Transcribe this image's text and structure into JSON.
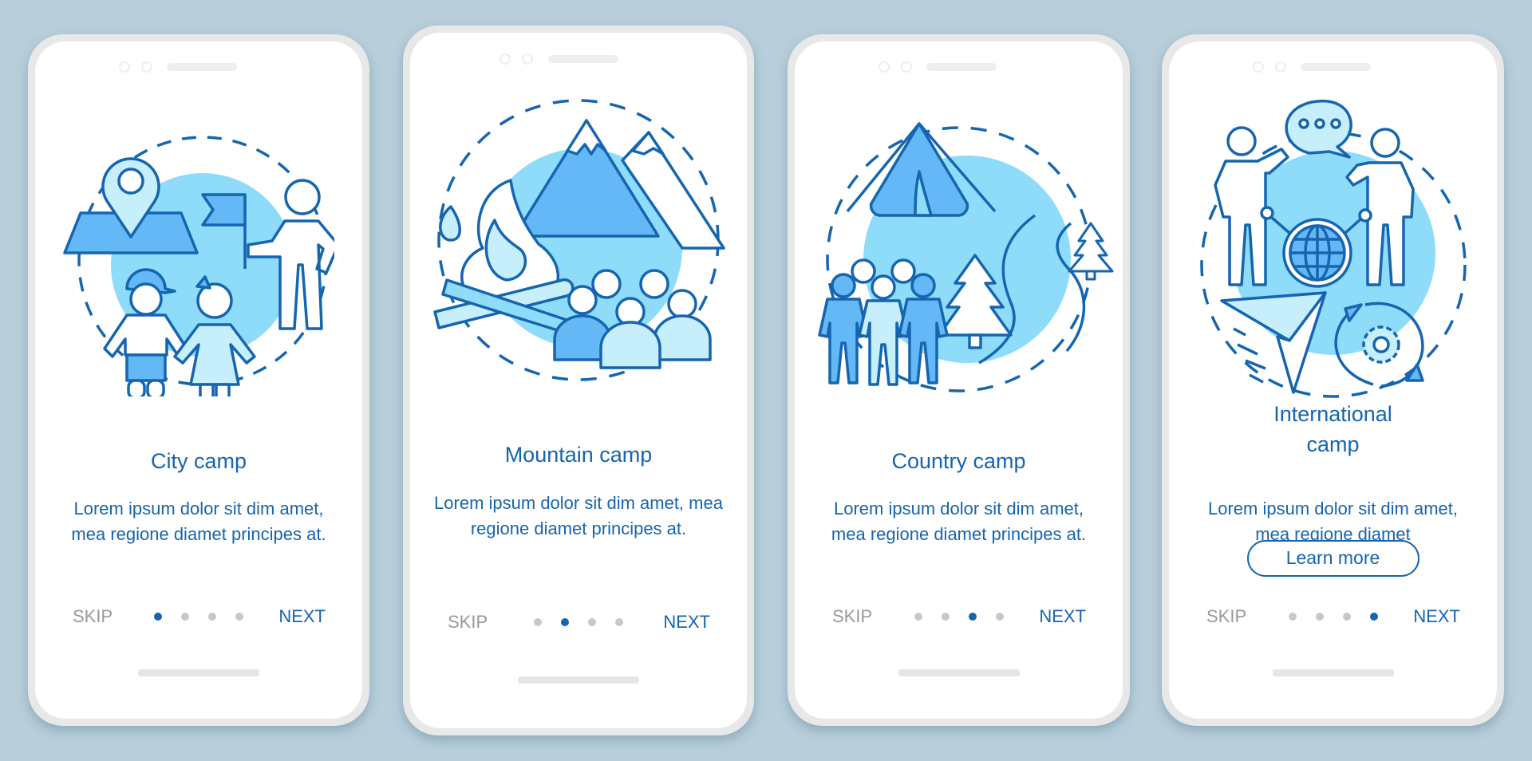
{
  "theme": {
    "background": "#b8cfdb",
    "accent": "#1565b0",
    "muted_text": "#999999",
    "dot_inactive": "#c8c8c8",
    "illustration_fill_light": "#8fdcfa",
    "illustration_fill_mid": "#63b8f5",
    "illustration_fill_pale": "#c7eefb"
  },
  "screens": [
    {
      "title": "City camp",
      "body": "Lorem ipsum dolor sit dim amet, mea regione diamet principes at.",
      "illustration": "city-camp-illustration",
      "skip_label": "SKIP",
      "next_label": "NEXT",
      "page_index": 1,
      "page_count": 4
    },
    {
      "title": "Mountain camp",
      "body": "Lorem ipsum dolor sit dim amet, mea regione diamet principes at.",
      "illustration": "mountain-camp-illustration",
      "skip_label": "SKIP",
      "next_label": "NEXT",
      "page_index": 2,
      "page_count": 4
    },
    {
      "title": "Country camp",
      "body": "Lorem ipsum dolor sit dim amet, mea regione diamet principes at.",
      "illustration": "country-camp-illustration",
      "skip_label": "SKIP",
      "next_label": "NEXT",
      "page_index": 3,
      "page_count": 4
    },
    {
      "title_line1": "International",
      "title_line2": "camp",
      "body": "Lorem ipsum dolor sit dim amet, mea regione diamet",
      "illustration": "international-camp-illustration",
      "button_label": "Learn more",
      "skip_label": "SKIP",
      "next_label": "NEXT",
      "page_index": 4,
      "page_count": 4
    }
  ]
}
